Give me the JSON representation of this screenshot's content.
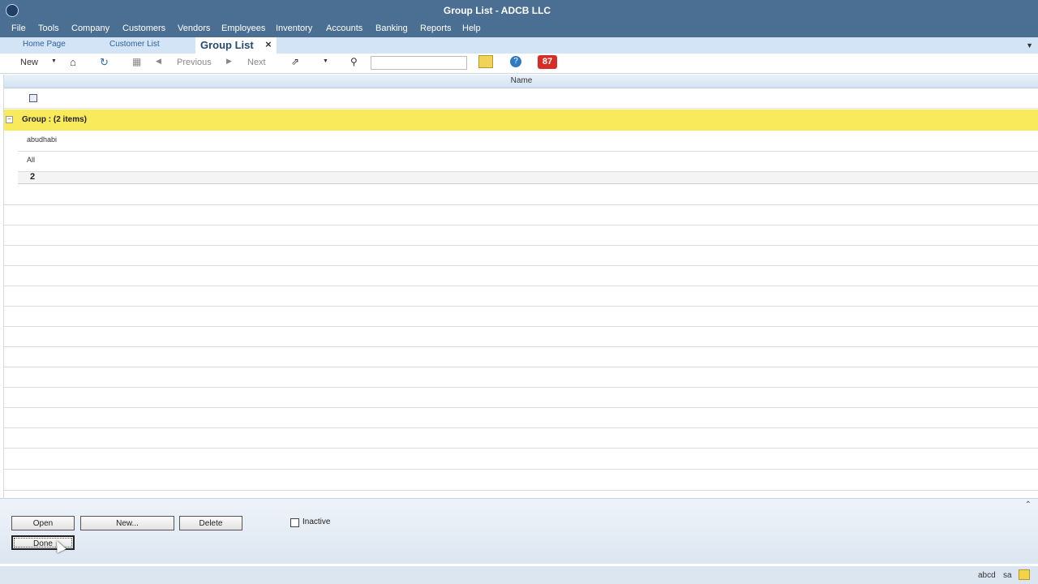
{
  "window": {
    "title": "Group List - ADCB LLC"
  },
  "menu": [
    "File",
    "Tools",
    "Company",
    "Customers",
    "Vendors",
    "Employees",
    "Inventory",
    "Accounts",
    "Banking",
    "Reports",
    "Help"
  ],
  "tabs": {
    "home": "Home Page",
    "customer_list": "Customer List",
    "active": "Group List",
    "close": "×"
  },
  "toolbar": {
    "new_label": "New",
    "previous_label": "Previous",
    "next_label": "Next",
    "search_value": "",
    "badge_count": "87"
  },
  "grid": {
    "column_header": "Name",
    "group_label": "Group :  (2 items)",
    "rows": [
      "abudhabi",
      "All"
    ],
    "summary": "2"
  },
  "buttons": {
    "open": "Open",
    "new": "New...",
    "delete": "Delete",
    "done": "Done",
    "inactive_label": "Inactive"
  },
  "status": {
    "user1": "abcd",
    "user2": "sa"
  },
  "colors": {
    "title_bar": "#4a6f92",
    "tab_bar": "#d3e4f7",
    "group_row": "#f9ea5c",
    "badge": "#d62e26"
  }
}
